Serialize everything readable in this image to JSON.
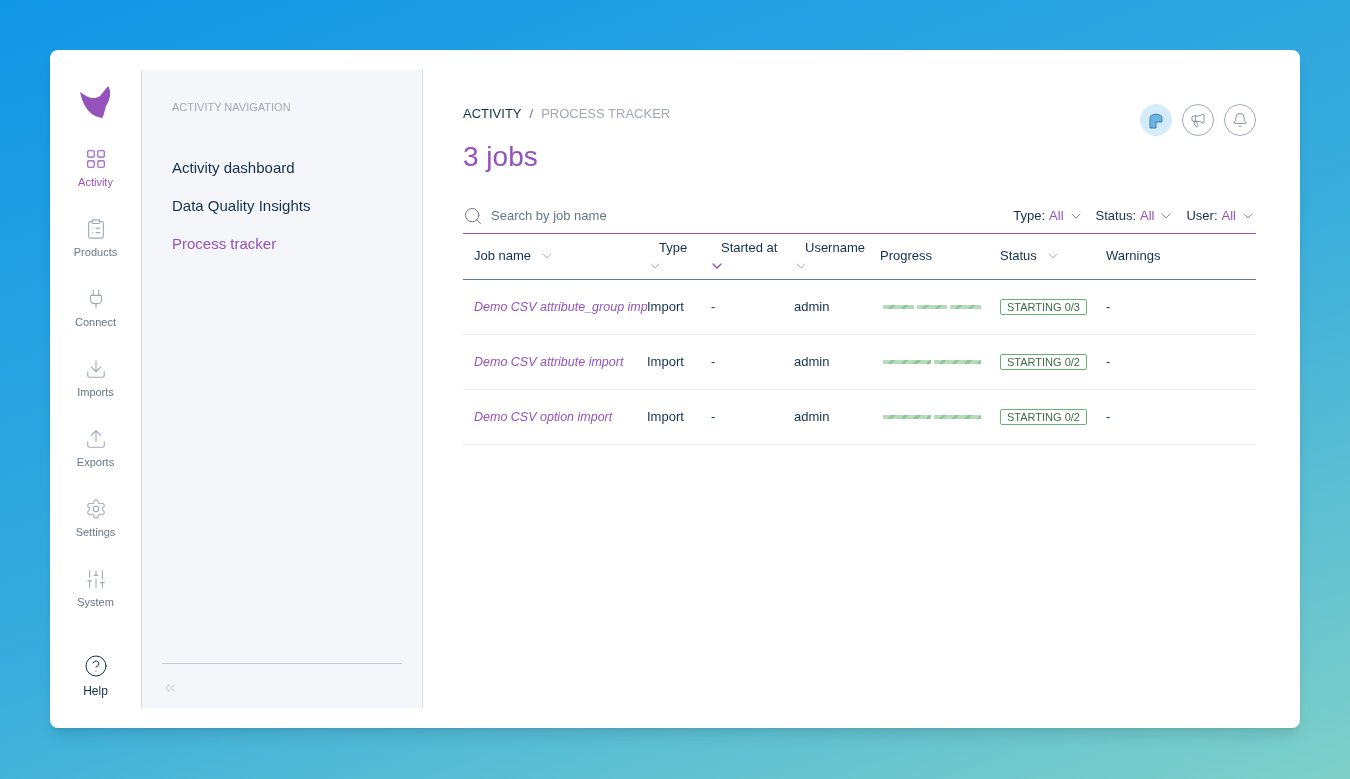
{
  "sidebar": {
    "items": [
      {
        "label": "Activity",
        "selected": true
      },
      {
        "label": "Products",
        "selected": false
      },
      {
        "label": "Connect",
        "selected": false
      },
      {
        "label": "Imports",
        "selected": false
      },
      {
        "label": "Exports",
        "selected": false
      },
      {
        "label": "Settings",
        "selected": false
      },
      {
        "label": "System",
        "selected": false
      }
    ],
    "help": {
      "label": "Help"
    }
  },
  "navigation": {
    "title": "ACTIVITY NAVIGATION",
    "items": [
      {
        "label": "Activity dashboard",
        "selected": false
      },
      {
        "label": "Data Quality Insights",
        "selected": false
      },
      {
        "label": "Process tracker",
        "selected": true
      }
    ]
  },
  "breadcrumb": [
    "ACTIVITY",
    "PROCESS TRACKER"
  ],
  "breadcrumb_separator": "/",
  "title": "3 jobs",
  "search": {
    "placeholder": "Search by job name"
  },
  "filters": [
    {
      "label": "Type:",
      "value": "All"
    },
    {
      "label": "Status:",
      "value": "All"
    },
    {
      "label": "User:",
      "value": "All"
    }
  ],
  "table": {
    "columns": [
      {
        "label": "Job name",
        "sortable": true,
        "selected": false
      },
      {
        "label": "Type",
        "sortable": true,
        "selected": false
      },
      {
        "label": "Started at",
        "sortable": true,
        "selected": true
      },
      {
        "label": "Username",
        "sortable": true,
        "selected": false
      },
      {
        "label": "Progress",
        "sortable": false,
        "selected": false
      },
      {
        "label": "Status",
        "sortable": true,
        "selected": false
      },
      {
        "label": "Warnings",
        "sortable": false,
        "selected": false
      }
    ],
    "rows": [
      {
        "job_name": "Demo CSV attribute_group imp",
        "type": "Import",
        "started_at": "-",
        "username": "admin",
        "steps": [
          {
            "done": false
          },
          {
            "done": false
          },
          {
            "done": false
          }
        ],
        "status": "STARTING 0/3",
        "warnings": "-"
      },
      {
        "job_name": "Demo CSV attribute import",
        "type": "Import",
        "started_at": "-",
        "username": "admin",
        "steps": [
          {
            "done": false
          },
          {
            "done": false
          }
        ],
        "status": "STARTING 0/2",
        "warnings": "-"
      },
      {
        "job_name": "Demo CSV option import",
        "type": "Import",
        "started_at": "-",
        "username": "admin",
        "steps": [
          {
            "done": false
          },
          {
            "done": false
          }
        ],
        "status": "STARTING 0/2",
        "warnings": "-"
      }
    ]
  }
}
